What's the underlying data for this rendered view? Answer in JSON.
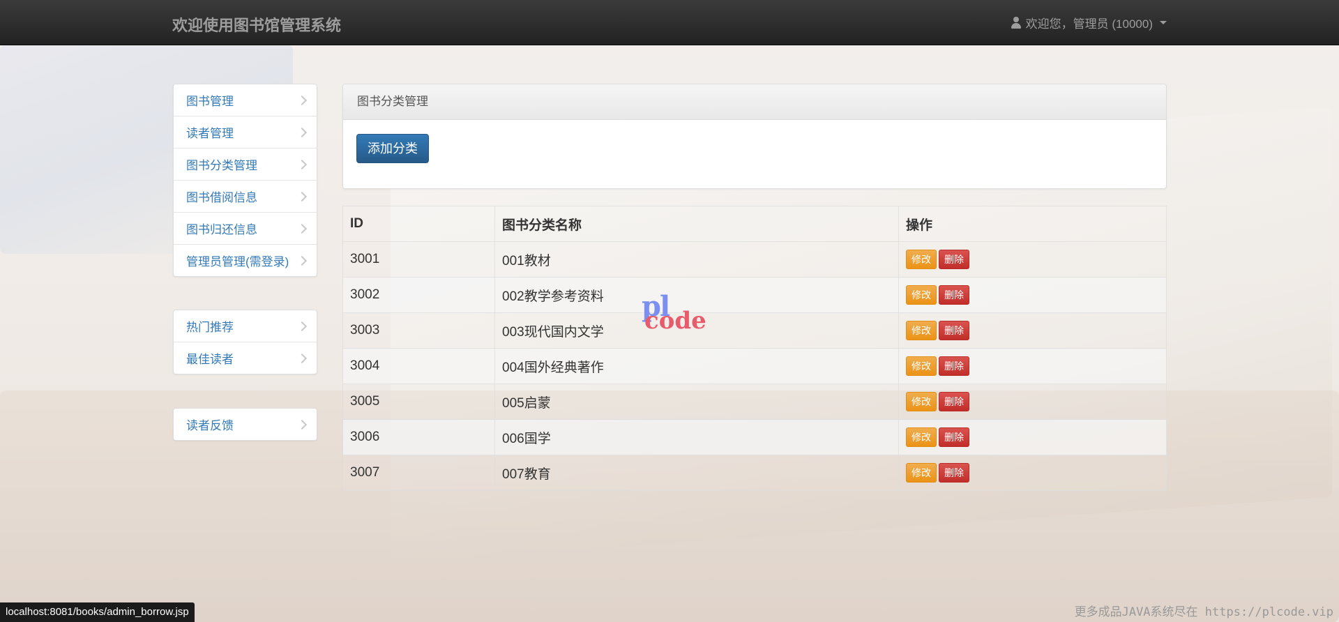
{
  "navbar": {
    "brand": "欢迎使用图书馆管理系统",
    "user_label": "欢迎您，管理员 (10000)"
  },
  "sidebar": {
    "group1": [
      {
        "label": "图书管理"
      },
      {
        "label": "读者管理"
      },
      {
        "label": "图书分类管理"
      },
      {
        "label": "图书借阅信息"
      },
      {
        "label": "图书归还信息"
      },
      {
        "label": "管理员管理(需登录)"
      }
    ],
    "group2": [
      {
        "label": "热门推荐"
      },
      {
        "label": "最佳读者"
      }
    ],
    "group3": [
      {
        "label": "读者反馈"
      }
    ]
  },
  "panel": {
    "heading": "图书分类管理",
    "add_button": "添加分类"
  },
  "table": {
    "headers": {
      "id": "ID",
      "name": "图书分类名称",
      "action": "操作"
    },
    "edit_label": "修改",
    "delete_label": "删除",
    "rows": [
      {
        "id": "3001",
        "name": "001教材"
      },
      {
        "id": "3002",
        "name": "002教学参考资料"
      },
      {
        "id": "3003",
        "name": "003现代国内文学"
      },
      {
        "id": "3004",
        "name": "004国外经典著作"
      },
      {
        "id": "3005",
        "name": "005启蒙"
      },
      {
        "id": "3006",
        "name": "006国学"
      },
      {
        "id": "3007",
        "name": "007教育"
      }
    ]
  },
  "watermark": {
    "pl": "pl",
    "code": "code"
  },
  "status_bar": {
    "url": "localhost:8081/books/admin_borrow.jsp"
  },
  "footer": {
    "text": "更多成品JAVA系统尽在 https://plcode.vip"
  },
  "colors": {
    "link": "#337ab7",
    "primary": "#337ab7",
    "warning": "#f0ad4e",
    "danger": "#d9534f",
    "navbar": "#222222"
  }
}
